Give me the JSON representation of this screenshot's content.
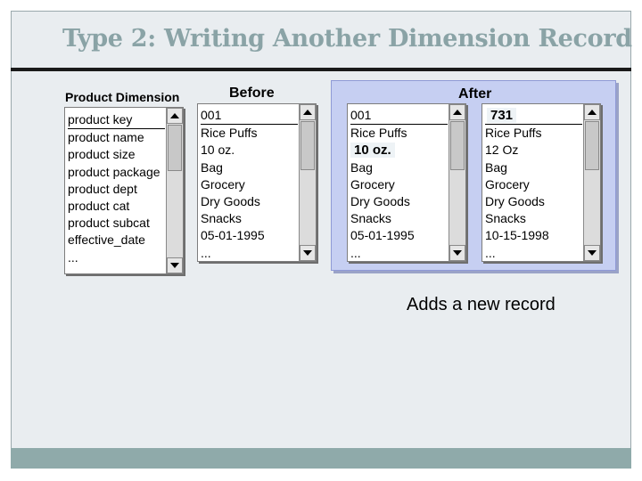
{
  "title": "Type 2: Writing Another Dimension Record",
  "labels": {
    "product_dimension": "Product Dimension",
    "before": "Before",
    "after": "After"
  },
  "product_dimension_fields": [
    "product key",
    "product name",
    "product size",
    "product package",
    "product dept",
    "product cat",
    "product subcat",
    "effective_date",
    "..."
  ],
  "before_record": [
    "001",
    "Rice Puffs",
    "10 oz.",
    "Bag",
    "Grocery",
    "Dry Goods",
    "Snacks",
    "05-01-1995",
    "..."
  ],
  "after_old_record": [
    "001",
    "Rice Puffs",
    "10 oz.",
    "Bag",
    "Grocery",
    "Dry Goods",
    "Snacks",
    "05-01-1995",
    "..."
  ],
  "after_new_record": [
    "731",
    "Rice Puffs",
    "12 Oz",
    "Bag",
    "Grocery",
    "Dry Goods",
    "Snacks",
    "10-15-1998",
    "..."
  ],
  "caption": "Adds a new record",
  "colors": {
    "title": "#8aa3a6",
    "after_panel": "#c6cff2",
    "footer_band": "#8faaaa"
  }
}
